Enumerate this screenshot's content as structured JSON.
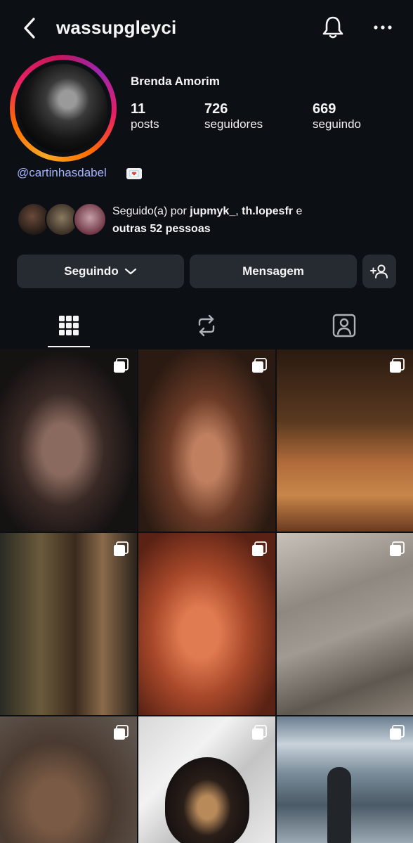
{
  "header": {
    "username": "wassupgleyci"
  },
  "profile": {
    "full_name": "Brenda Amorim",
    "stats": [
      {
        "value": "11",
        "label": "posts"
      },
      {
        "value": "726",
        "label": "seguidores"
      },
      {
        "value": "669",
        "label": "seguindo"
      }
    ],
    "link": "@cartinhasdabel",
    "link_emoji": "💌"
  },
  "followed_by": {
    "prefix": "Seguido(a) por ",
    "user1": "jupmyk_",
    "separator": ", ",
    "user2": "th.lopesfr",
    "conj": " e",
    "others": "outras 52 pessoas"
  },
  "actions": {
    "following_label": "Seguindo",
    "message_label": "Mensagem"
  },
  "tabs": [
    "grid-icon",
    "reels-icon",
    "tagged-icon"
  ],
  "colors": {
    "background": "#0c0f14",
    "button": "#262a31",
    "link": "#a5b4ff"
  },
  "posts": [
    {
      "icon": "multiple-photos-icon"
    },
    {
      "icon": "multiple-photos-icon"
    },
    {
      "icon": "multiple-photos-icon"
    },
    {
      "icon": "multiple-photos-icon"
    },
    {
      "icon": "multiple-photos-icon"
    },
    {
      "icon": "multiple-photos-icon"
    },
    {
      "icon": "multiple-photos-icon"
    },
    {
      "icon": "multiple-photos-icon"
    },
    {
      "icon": "multiple-photos-icon"
    }
  ]
}
